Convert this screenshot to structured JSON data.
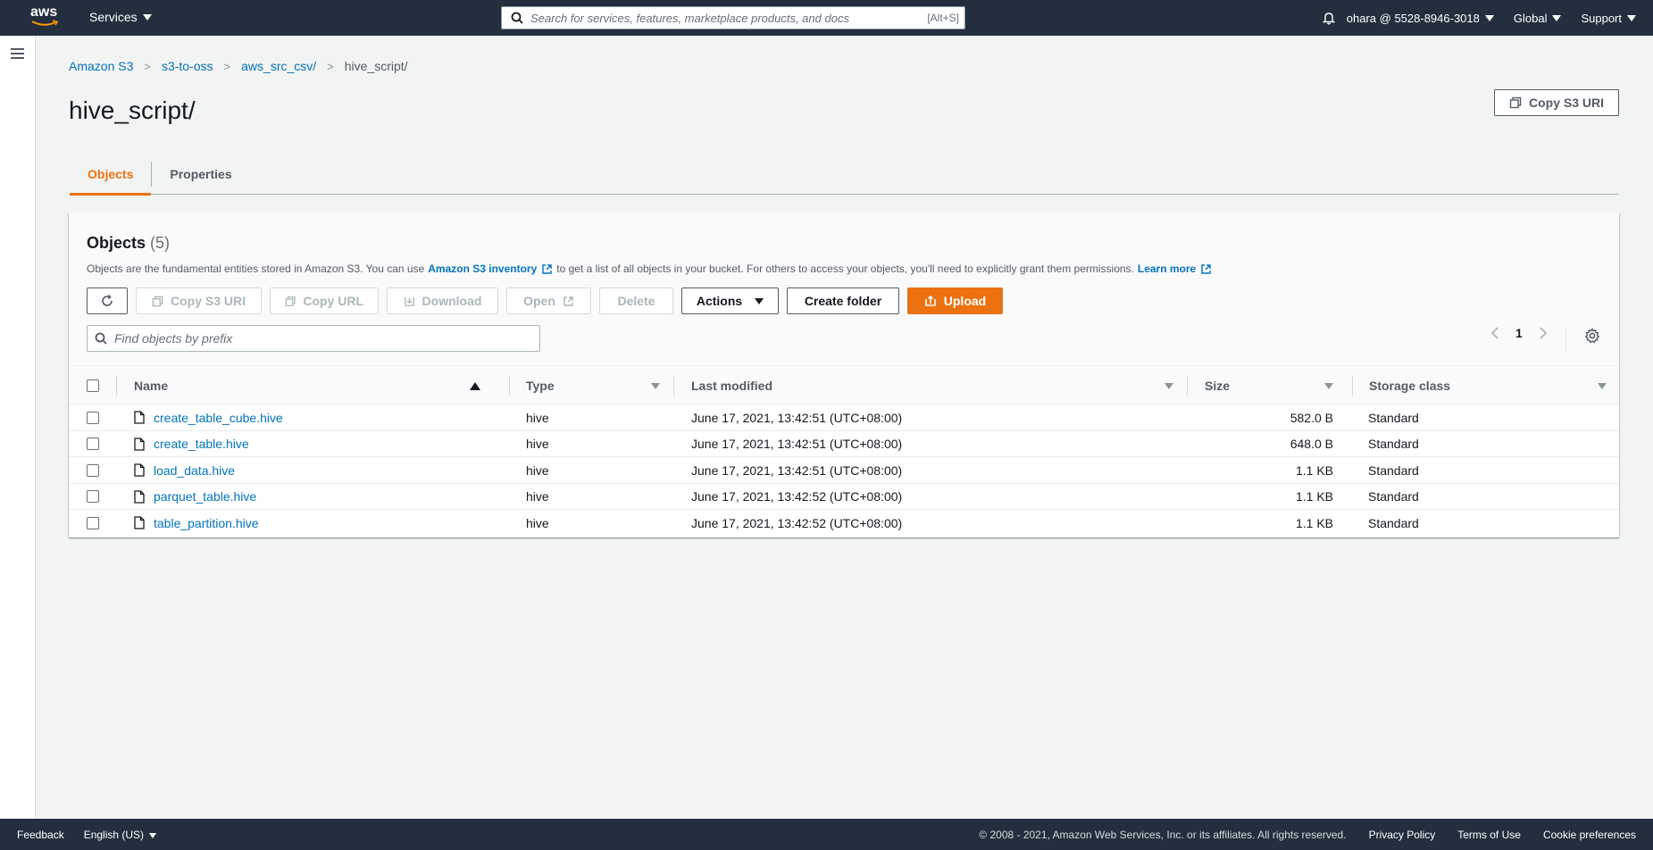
{
  "topnav": {
    "logo_text": "aws",
    "services_label": "Services",
    "search_placeholder": "Search for services, features, marketplace products, and docs",
    "search_hint": "[Alt+S]",
    "account": "ohara @ 5528-8946-3018",
    "region": "Global",
    "support": "Support"
  },
  "breadcrumb": {
    "items": [
      "Amazon S3",
      "s3-to-oss",
      "aws_src_csv/"
    ],
    "current": "hive_script/"
  },
  "page": {
    "title": "hive_script/",
    "copy_uri_label": "Copy S3 URI"
  },
  "tabs": [
    {
      "label": "Objects",
      "active": true
    },
    {
      "label": "Properties",
      "active": false
    }
  ],
  "objects": {
    "title": "Objects",
    "count": "(5)",
    "desc_part1": "Objects are the fundamental entities stored in Amazon S3. You can use",
    "desc_link1": "Amazon S3 inventory",
    "desc_part2": "to get a list of all objects in your bucket. For others to access your objects, you'll need to explicitly grant them permissions.",
    "desc_link2": "Learn more",
    "toolbar": {
      "copy_s3_uri": "Copy S3 URI",
      "copy_url": "Copy URL",
      "download": "Download",
      "open": "Open",
      "delete": "Delete",
      "actions": "Actions",
      "create_folder": "Create folder",
      "upload": "Upload"
    },
    "filter_placeholder": "Find objects by prefix",
    "page_number": "1",
    "columns": [
      "Name",
      "Type",
      "Last modified",
      "Size",
      "Storage class"
    ],
    "rows": [
      {
        "name": "create_table_cube.hive",
        "type": "hive",
        "modified": "June 17, 2021, 13:42:51 (UTC+08:00)",
        "size": "582.0 B",
        "storage": "Standard"
      },
      {
        "name": "create_table.hive",
        "type": "hive",
        "modified": "June 17, 2021, 13:42:51 (UTC+08:00)",
        "size": "648.0 B",
        "storage": "Standard"
      },
      {
        "name": "load_data.hive",
        "type": "hive",
        "modified": "June 17, 2021, 13:42:51 (UTC+08:00)",
        "size": "1.1 KB",
        "storage": "Standard"
      },
      {
        "name": "parquet_table.hive",
        "type": "hive",
        "modified": "June 17, 2021, 13:42:52 (UTC+08:00)",
        "size": "1.1 KB",
        "storage": "Standard"
      },
      {
        "name": "table_partition.hive",
        "type": "hive",
        "modified": "June 17, 2021, 13:42:52 (UTC+08:00)",
        "size": "1.1 KB",
        "storage": "Standard"
      }
    ]
  },
  "footer": {
    "feedback": "Feedback",
    "language": "English (US)",
    "copyright": "© 2008 - 2021, Amazon Web Services, Inc. or its affiliates. All rights reserved.",
    "privacy": "Privacy Policy",
    "terms": "Terms of Use",
    "cookies": "Cookie preferences"
  },
  "colors": {
    "nav_bg": "#232f3e",
    "accent": "#ec7211",
    "link": "#0073bb"
  }
}
